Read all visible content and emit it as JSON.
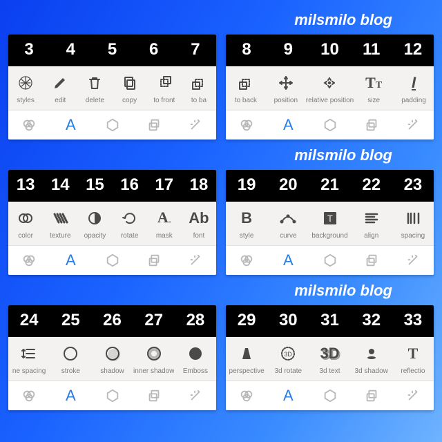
{
  "watermark": "milsmilo blog",
  "rows": [
    {
      "left": {
        "nums": [
          "3",
          "4",
          "5",
          "6",
          "7"
        ],
        "tools": [
          {
            "icon": "styles",
            "label": "styles"
          },
          {
            "icon": "edit",
            "label": "edit"
          },
          {
            "icon": "delete",
            "label": "delete"
          },
          {
            "icon": "copy",
            "label": "copy"
          },
          {
            "icon": "to-front",
            "label": "to front"
          },
          {
            "icon": "to-back",
            "label": "to ba"
          }
        ]
      },
      "right": {
        "nums": [
          "8",
          "9",
          "10",
          "11",
          "12"
        ],
        "tools": [
          {
            "icon": "to-back",
            "label": "to back"
          },
          {
            "icon": "position",
            "label": "position"
          },
          {
            "icon": "relative-position",
            "label": "relative position"
          },
          {
            "icon": "size",
            "label": "size"
          },
          {
            "icon": "padding",
            "label": "padding"
          }
        ]
      }
    },
    {
      "left": {
        "nums": [
          "13",
          "14",
          "15",
          "16",
          "17",
          "18"
        ],
        "tools": [
          {
            "icon": "color",
            "label": "color"
          },
          {
            "icon": "texture",
            "label": "texture"
          },
          {
            "icon": "opacity",
            "label": "opacity"
          },
          {
            "icon": "rotate",
            "label": "rotate"
          },
          {
            "icon": "mask",
            "label": "mask"
          },
          {
            "icon": "font",
            "label": "font"
          }
        ]
      },
      "right": {
        "nums": [
          "19",
          "20",
          "21",
          "22",
          "23"
        ],
        "tools": [
          {
            "icon": "text-style",
            "label": "style"
          },
          {
            "icon": "curve",
            "label": "curve"
          },
          {
            "icon": "background",
            "label": "background"
          },
          {
            "icon": "align",
            "label": "align"
          },
          {
            "icon": "spacing",
            "label": "spacing"
          }
        ]
      }
    },
    {
      "left": {
        "nums": [
          "24",
          "25",
          "26",
          "27",
          "28"
        ],
        "tools": [
          {
            "icon": "line-spacing",
            "label": "ne spacing"
          },
          {
            "icon": "stroke",
            "label": "stroke"
          },
          {
            "icon": "shadow",
            "label": "shadow"
          },
          {
            "icon": "inner-shadow",
            "label": "inner shadow"
          },
          {
            "icon": "emboss",
            "label": "Emboss"
          }
        ]
      },
      "right": {
        "nums": [
          "29",
          "30",
          "31",
          "32",
          "33"
        ],
        "tools": [
          {
            "icon": "perspective",
            "label": "perspective"
          },
          {
            "icon": "3d-rotate",
            "label": "3d rotate"
          },
          {
            "icon": "3d-text",
            "label": "3d text"
          },
          {
            "icon": "3d-shadow",
            "label": "3d shadow"
          },
          {
            "icon": "reflection",
            "label": "reflectio"
          }
        ]
      }
    }
  ],
  "tabs": [
    {
      "icon": "color-tab",
      "active": false
    },
    {
      "icon": "a-tab",
      "active": true
    },
    {
      "icon": "shape-tab",
      "active": false
    },
    {
      "icon": "layer-tab",
      "active": false
    },
    {
      "icon": "wand-tab",
      "active": false
    }
  ]
}
